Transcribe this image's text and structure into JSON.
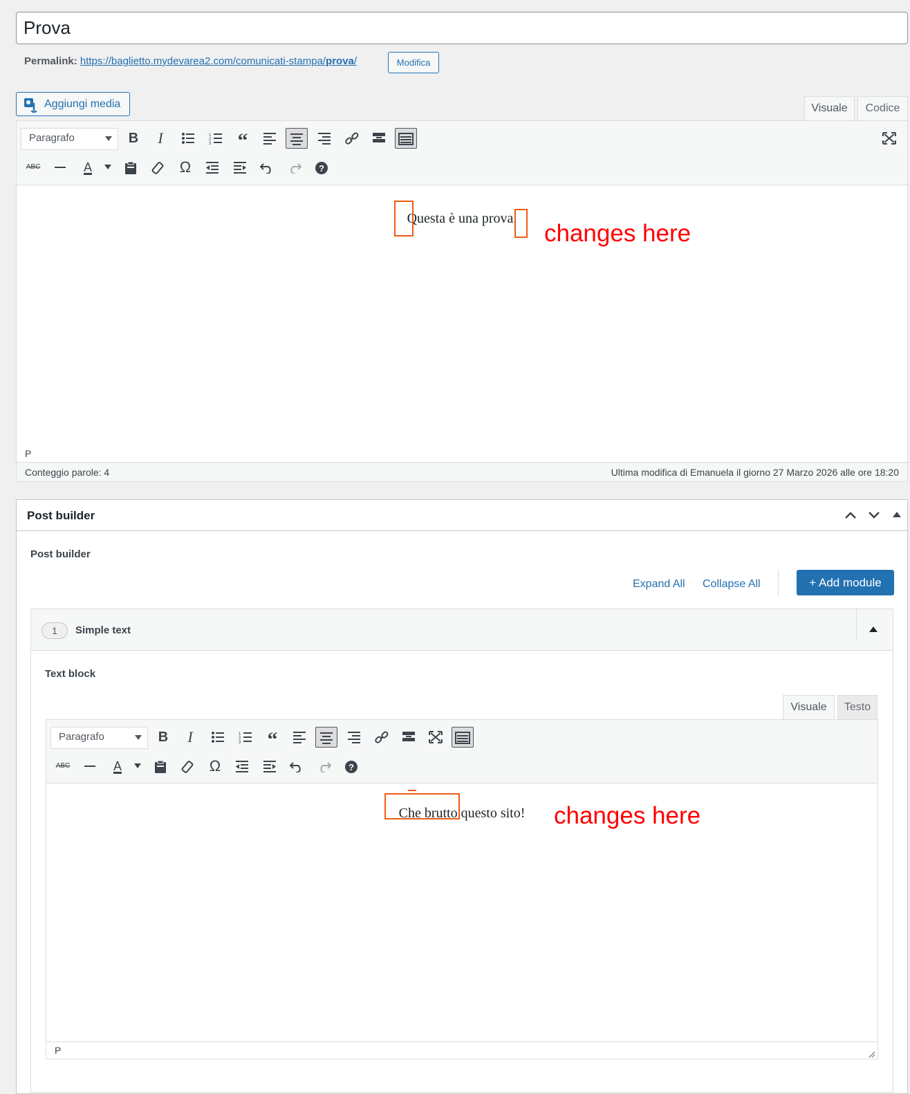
{
  "post": {
    "title": "Prova",
    "permalink_label": "Permalink:",
    "permalink_url_prefix": "https://baglietto.mydevarea2.com/comunicati-stampa/",
    "permalink_slug": "prova",
    "permalink_url_suffix": "/",
    "edit_button": "Modifica"
  },
  "media": {
    "add_media_label": "Aggiungi media"
  },
  "editor_tabs": {
    "visual": "Visuale",
    "code": "Codice"
  },
  "main_editor": {
    "format_select": "Paragrafo",
    "content_text": "Questa è una prova.",
    "path": "P",
    "word_count": "Conteggio parole: 4",
    "last_modified": "Ultima modifica di Emanuela il giorno 27 Marzo 2026 alle ore 18:20"
  },
  "annotation": {
    "label": "changes here",
    "color": "#ff0000",
    "box_color": "#f05a14"
  },
  "post_builder": {
    "box_title": "Post builder",
    "section_label": "Post builder",
    "expand_all": "Expand All",
    "collapse_all": "Collapse All",
    "add_module": "+ Add module",
    "module": {
      "index": "1",
      "name": "Simple text",
      "field_label": "Text block",
      "tab_visual": "Visuale",
      "tab_text": "Testo",
      "format_select": "Paragrafo",
      "content_text_highlight": "Che brutto",
      "content_text_rest": " questo sito!",
      "path": "P"
    }
  },
  "colors": {
    "accent": "#2271b1",
    "background": "#f0f0f1"
  }
}
